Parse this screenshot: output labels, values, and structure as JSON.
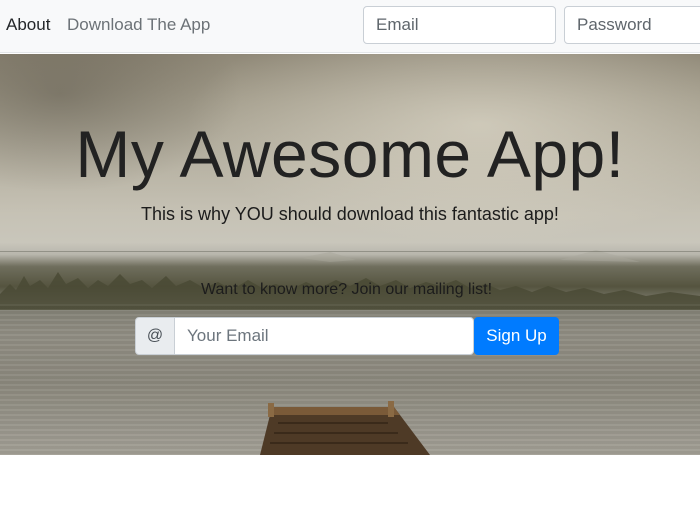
{
  "nav": {
    "links": [
      {
        "label": "About"
      },
      {
        "label": "Download The App"
      }
    ],
    "email_placeholder": "Email",
    "password_placeholder": "Password"
  },
  "hero": {
    "title": "My Awesome App!",
    "subtitle": "This is why YOU should download this fantastic app!",
    "mailing_text": "Want to know more? Join our mailing list!",
    "addon_symbol": "@",
    "email_placeholder": "Your Email",
    "signup_label": "Sign Up"
  },
  "colors": {
    "primary_button": "#007bff",
    "navbar_background": "#f8f9fa"
  }
}
